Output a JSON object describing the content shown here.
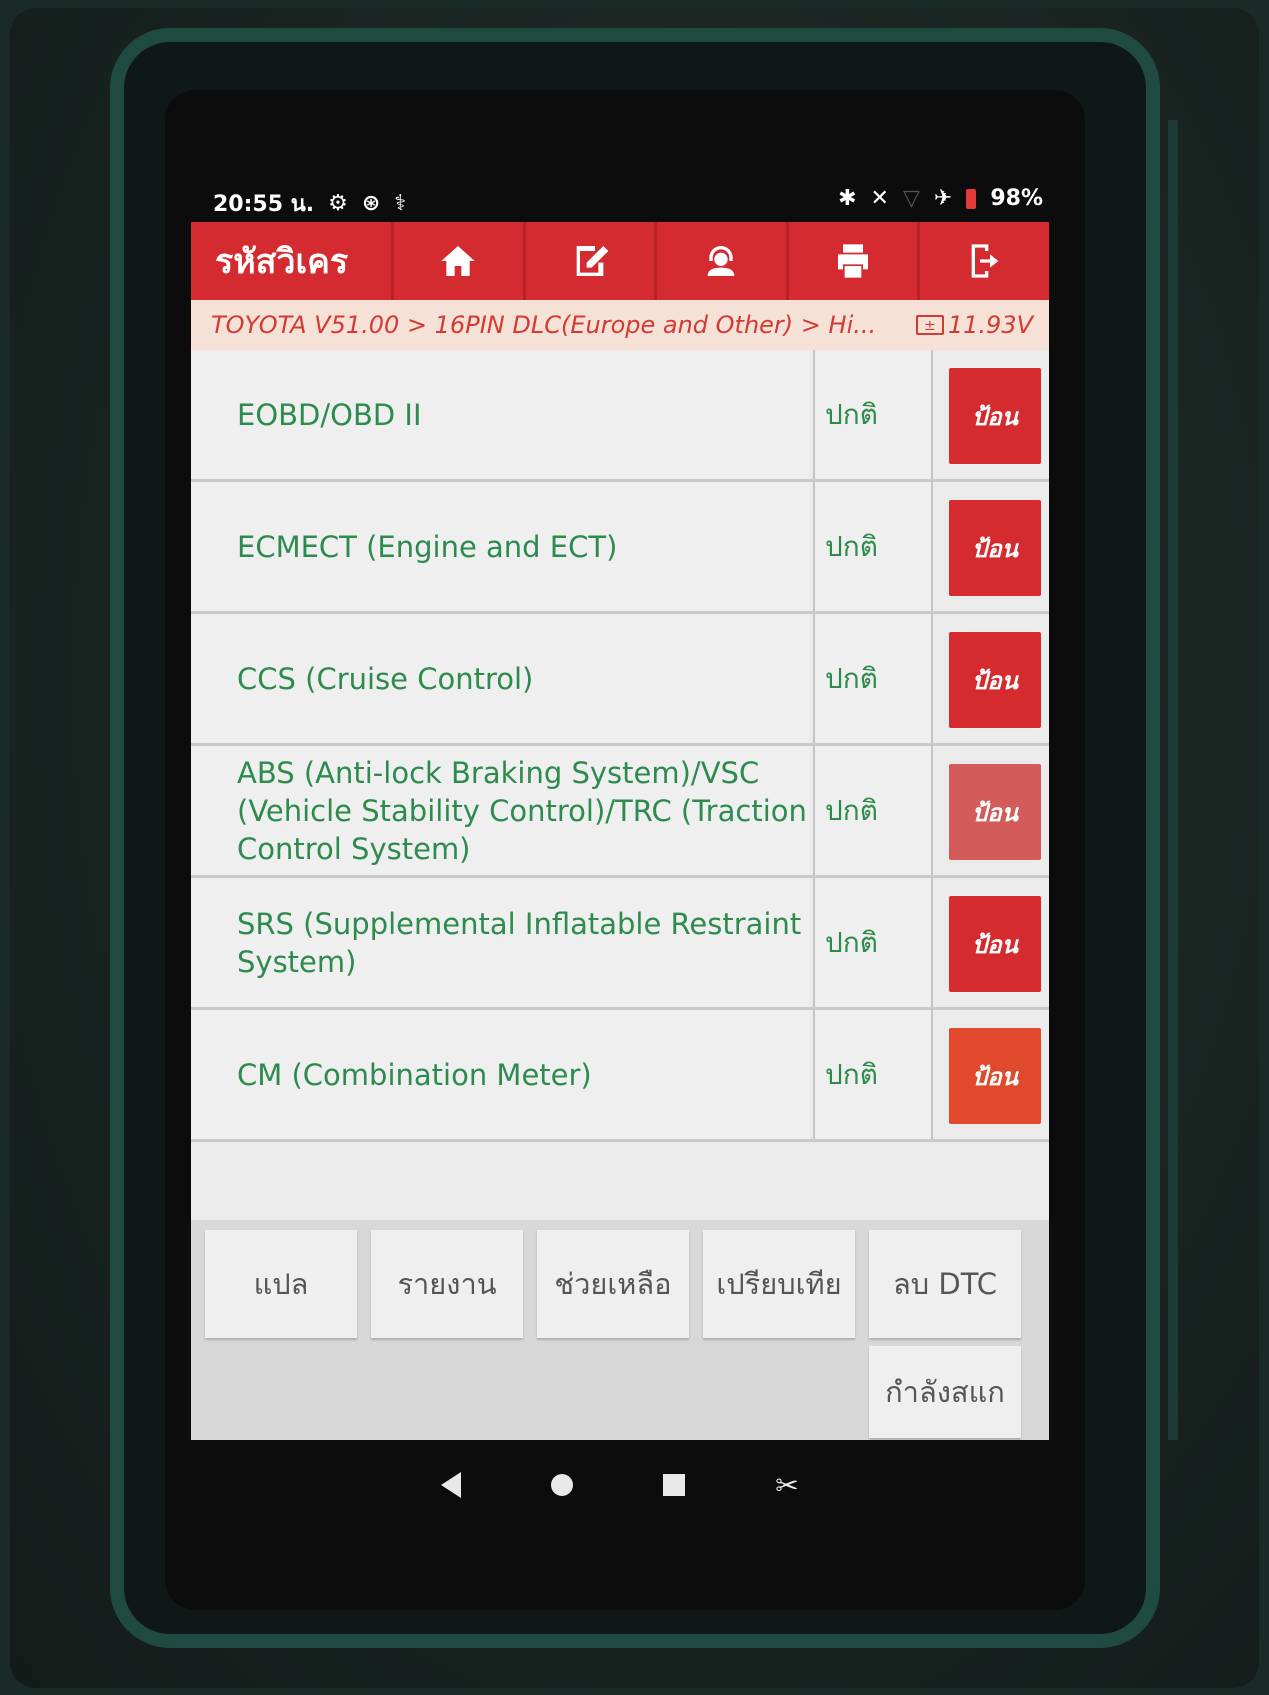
{
  "status_bar": {
    "time": "20:55 น.",
    "battery": "98%"
  },
  "app": {
    "title": "รหัสวิเคร"
  },
  "toolbar": {
    "tools": [
      {
        "name": "home-icon"
      },
      {
        "name": "edit-icon"
      },
      {
        "name": "support-icon"
      },
      {
        "name": "print-icon"
      },
      {
        "name": "exit-icon"
      }
    ]
  },
  "breadcrumb": {
    "path": "TOYOTA V51.00 > 16PIN DLC(Europe and Other) > Hi...",
    "voltage": "11.93V"
  },
  "systems": [
    {
      "name": "EOBD/OBD II",
      "status": "ปกติ",
      "button": "ป้อน"
    },
    {
      "name": "ECMECT (Engine and ECT)",
      "status": "ปกติ",
      "button": "ป้อน"
    },
    {
      "name": "CCS (Cruise Control)",
      "status": "ปกติ",
      "button": "ป้อน"
    },
    {
      "name": "ABS (Anti-lock Braking System)/VSC (Vehicle Stability Control)/TRC (Traction Control System)",
      "status": "ปกติ",
      "button": "ป้อน"
    },
    {
      "name": "SRS (Supplemental Inflatable Restraint System)",
      "status": "ปกติ",
      "button": "ป้อน"
    },
    {
      "name": "CM (Combination Meter)",
      "status": "ปกติ",
      "button": "ป้อน"
    }
  ],
  "actions": {
    "translate": "แปล",
    "report": "รายงาน",
    "help": "ช่วยเหลือ",
    "compare": "เปรียบเทีย",
    "clear_dtc": "ลบ DTC",
    "scanning": "กำลังสแก"
  },
  "colors": {
    "accent": "#d32b2f",
    "text_green": "#2e8b4e",
    "breadcrumb_text": "#d43a33"
  }
}
